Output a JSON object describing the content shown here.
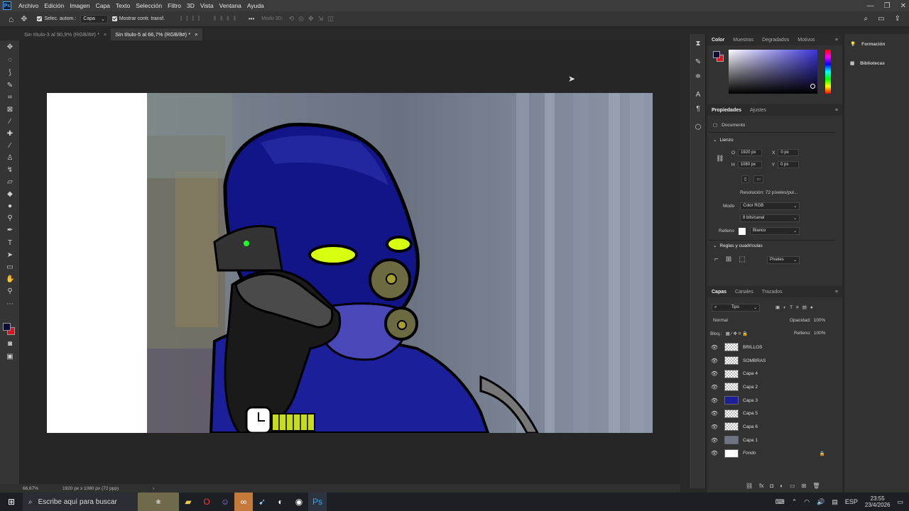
{
  "menu": {
    "items": [
      "Archivo",
      "Edición",
      "Imagen",
      "Capa",
      "Texto",
      "Selección",
      "Filtro",
      "3D",
      "Vista",
      "Ventana",
      "Ayuda"
    ]
  },
  "options": {
    "auto_select": "Selec. autom.:",
    "layer_select": "Capa",
    "show_transform": "Mostrar contr. transf.",
    "mode3d": "Modo 3D:",
    "more": "•••"
  },
  "tabs": [
    {
      "label": "Sin título-3 al 90,9% (RGB/8#) *"
    },
    {
      "label": "Sin título-5 al 66,7% (RGB/8#) *"
    }
  ],
  "status": {
    "zoom": "66,67%",
    "doc": "1920 px x 1080 px (72 ppp)"
  },
  "color_panel": {
    "tabs": [
      "Color",
      "Muestras",
      "Degradados",
      "Motivos"
    ],
    "fg": "#0b0b3a",
    "bg": "#e0111a"
  },
  "props": {
    "tabs": [
      "Propiedades",
      "Ajustes"
    ],
    "doc_label": "Documento",
    "lienzo": "Lienzo",
    "w_label": "O",
    "w": "1920 px",
    "h_label": "H",
    "h": "1080 px",
    "x_label": "X",
    "x_val": "0 px",
    "y_label": "Y",
    "y_val": "0 px",
    "resolution": "Resolución: 72 píxeles/pul...",
    "mode_label": "Modo",
    "mode": "Color RGB",
    "bits": "8 bits/canal",
    "fill_label": "Relleno",
    "fill": "Blanco",
    "rulers": "Reglas y cuadrículas",
    "units": "Píxeles"
  },
  "layers_panel": {
    "tabs": [
      "Capas",
      "Canales",
      "Trazados"
    ],
    "kind": "Tipo",
    "blend": "Normal",
    "opacity_label": "Opacidad:",
    "opacity": "100%",
    "lock_label": "Bloq.:",
    "fill_label": "Relleno:",
    "fill": "100%",
    "layers": [
      {
        "name": "BRILLOS"
      },
      {
        "name": "SOMBRAS"
      },
      {
        "name": "Capa 4"
      },
      {
        "name": "Capa 2"
      },
      {
        "name": "Capa 3"
      },
      {
        "name": "Capa 5"
      },
      {
        "name": "Capa 6"
      },
      {
        "name": "Capa 1"
      },
      {
        "name": "Fondo"
      }
    ]
  },
  "learn": {
    "items": [
      "Formación",
      "Bibliotecas"
    ]
  },
  "taskbar": {
    "search": "Escribe aquí para buscar",
    "lang": "ESP",
    "time": "23:55",
    "date": "23/4/2026"
  }
}
